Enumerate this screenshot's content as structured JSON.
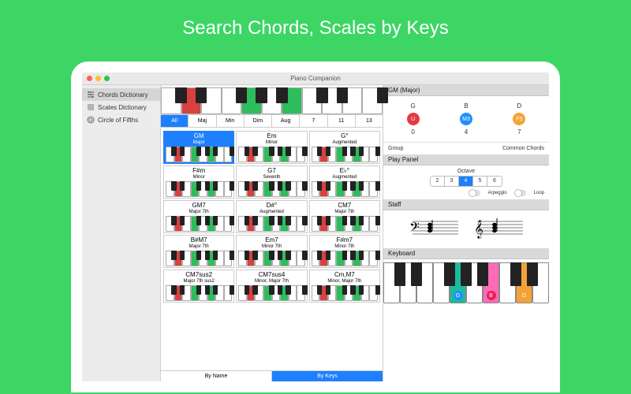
{
  "hero_title": "Search Chords, Scales by Keys",
  "window_title": "Piano Companion",
  "sidebar": {
    "items": [
      {
        "label": "Chords Dictionary",
        "icon": "chords-icon",
        "active": true
      },
      {
        "label": "Scales Dictionary",
        "icon": "scales-icon",
        "active": false
      },
      {
        "label": "Circle of Fifths",
        "icon": "circle-icon",
        "active": false
      }
    ]
  },
  "filters": {
    "tabs": [
      "All",
      "Maj",
      "Min",
      "Dim",
      "Aug",
      "7",
      "11",
      "13"
    ],
    "active": 0
  },
  "chord_grid": [
    {
      "name": "GM",
      "type": "Major",
      "selected": true
    },
    {
      "name": "Em",
      "type": "Minor"
    },
    {
      "name": "G°",
      "type": "Augmented"
    },
    {
      "name": "F#m",
      "type": "Minor"
    },
    {
      "name": "G7",
      "type": "Seventh"
    },
    {
      "name": "E♭°",
      "type": "Augmented"
    },
    {
      "name": "GM7",
      "type": "Major 7th"
    },
    {
      "name": "D#°",
      "type": "Augmented"
    },
    {
      "name": "CM7",
      "type": "Major 7th"
    },
    {
      "name": "B#M7",
      "type": "Major 7th"
    },
    {
      "name": "Em7",
      "type": "Minor 7th"
    },
    {
      "name": "F#m7",
      "type": "Minor 7th"
    },
    {
      "name": "CM7sus2",
      "type": "Major 7th sus2"
    },
    {
      "name": "CM7sus4",
      "type": "Minor, Major 7th"
    },
    {
      "name": "Cm,M7",
      "type": "Minor, Major 7th"
    }
  ],
  "bottom_tabs": {
    "tabs": [
      "By Name",
      "By Keys"
    ],
    "active": 1
  },
  "detail": {
    "header": "GM (Major)",
    "notes": {
      "labels": [
        "G",
        "B",
        "D"
      ],
      "badges": [
        "U",
        "M3",
        "P5"
      ],
      "intervals": [
        "0",
        "4",
        "7"
      ]
    },
    "group_label": "Group",
    "group_value": "Common Chords",
    "play_panel_header": "Play Panel",
    "octave_label": "Octave",
    "octave_values": [
      "2",
      "3",
      "4",
      "5",
      "6"
    ],
    "octave_active": 2,
    "arpeggio_label": "Arpeggio",
    "loop_label": "Loop",
    "staff_header": "Staff",
    "keyboard_header": "Keyboard",
    "keyboard_notes": [
      "G",
      "B",
      "D"
    ]
  },
  "colors": {
    "accent": "#1e7fff",
    "green": "#2dbd5c",
    "red": "#d94040",
    "background": "#3dd665"
  }
}
